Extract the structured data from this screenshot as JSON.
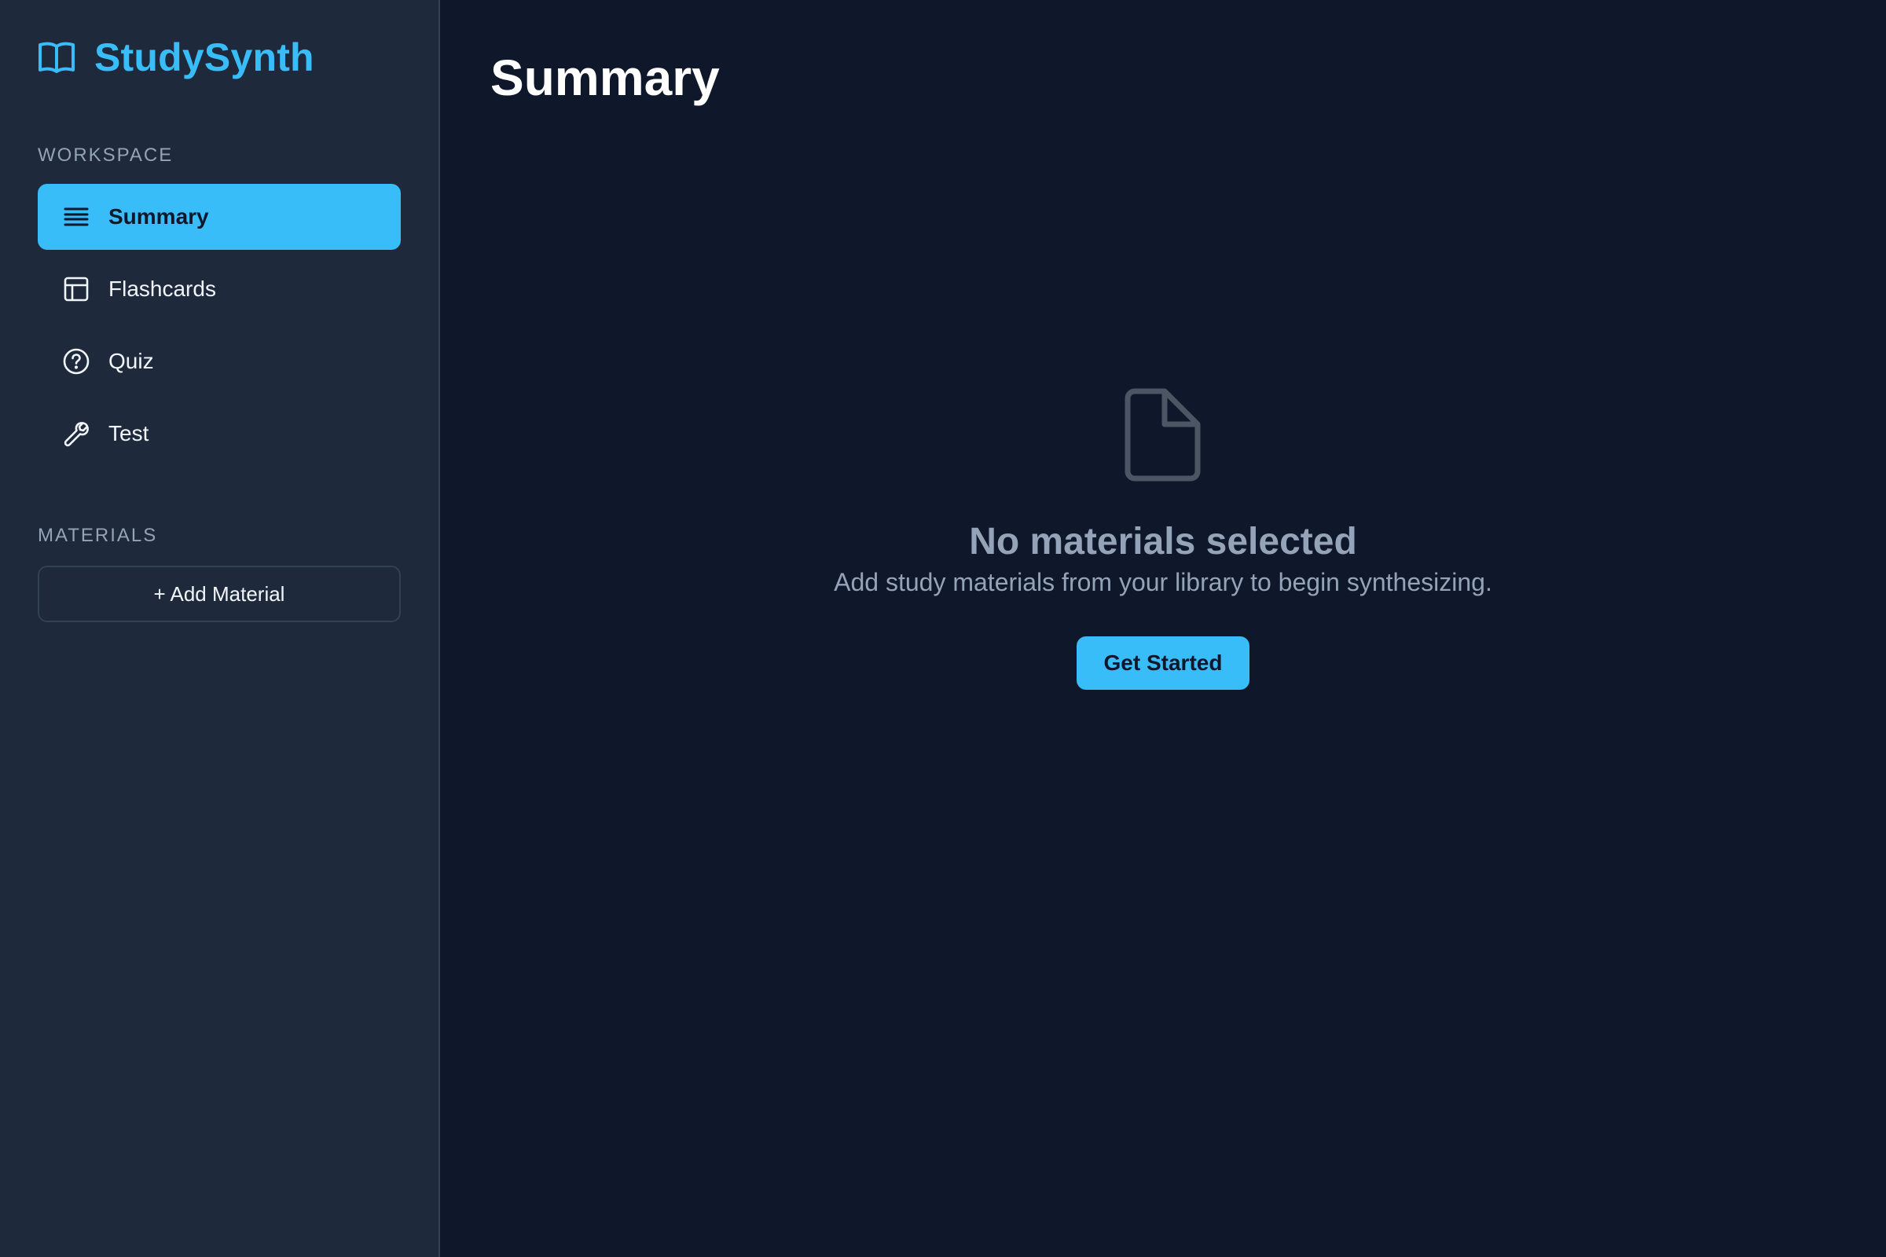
{
  "app": {
    "name": "StudySynth",
    "brand_icon": "open-book-icon",
    "accent_color": "#38bdf8"
  },
  "sidebar": {
    "workspace_label": "WORKSPACE",
    "items": [
      {
        "label": "Summary",
        "icon": "lines-icon",
        "active": true
      },
      {
        "label": "Flashcards",
        "icon": "layout-card-icon",
        "active": false
      },
      {
        "label": "Quiz",
        "icon": "question-circle-icon",
        "active": false
      },
      {
        "label": "Test",
        "icon": "wrench-icon",
        "active": false
      }
    ],
    "materials_label": "MATERIALS",
    "add_material_label": "+ Add Material"
  },
  "main": {
    "title": "Summary",
    "empty_state": {
      "icon": "document-icon",
      "title": "No materials selected",
      "subtitle": "Add study materials from your library to begin synthesizing.",
      "cta_label": "Get Started"
    }
  }
}
